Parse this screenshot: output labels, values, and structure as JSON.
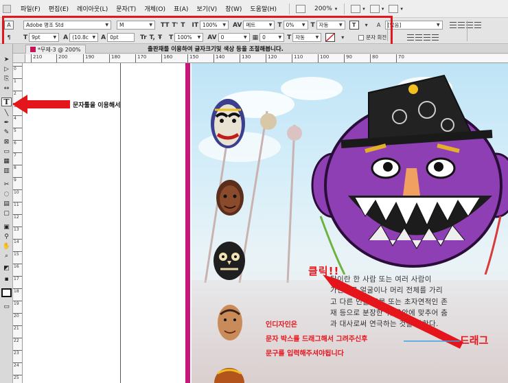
{
  "menu": {
    "items": [
      "파일(F)",
      "편집(E)",
      "레이아웃(L)",
      "문자(T)",
      "개체(O)",
      "표(A)",
      "보기(V)",
      "창(W)",
      "도움말(H)"
    ],
    "zoom": "200%"
  },
  "control_panel": {
    "font_family": "Adobe 명조 Std",
    "font_style": "M",
    "font_size": "9pt",
    "leading": "(10.8c",
    "tracking_field": "0pt",
    "vscale": "100%",
    "hscale": "100%",
    "kerning": "메트",
    "tracking": "0",
    "baseline": "0%",
    "skew": "0",
    "auto1": "자동",
    "auto2": "자동",
    "char_style": "[없음]",
    "rotate_label": "문자 회전"
  },
  "document": {
    "tab_title": "*무제-3 @ 200%",
    "banner": "출판재를 이용하여 글자크기및 색상 등을 조절해봅니다."
  },
  "ruler": {
    "h_ticks": [
      "210",
      "200",
      "190",
      "180",
      "170",
      "160",
      "150",
      "140",
      "130",
      "120",
      "110",
      "100",
      "90",
      "80",
      "70"
    ],
    "v_ticks": [
      "0",
      "1",
      "2",
      "3",
      "4",
      "5",
      "6",
      "7",
      "8",
      "9",
      "10",
      "11",
      "12",
      "13",
      "14",
      "15",
      "16",
      "17",
      "18",
      "19",
      "20",
      "21",
      "22",
      "23",
      "24",
      "25"
    ]
  },
  "body_text": {
    "lines": [
      "탈이란 한 사람 또는 여러 사람이",
      "가면으로 얼굴이나 머리 전체를 가리",
      "고 다른 인물·동물 또는 초자연적인 존",
      "재 등으로 분장한 뒤 음악에 맞추어 춤",
      "과 대사로써 연극하는 것을 말한다."
    ]
  },
  "annotations": {
    "tool_hint": "문자툴을 이용해서",
    "click": "클릭!!",
    "drag": "드래그",
    "instruction_lines": [
      "인디자인은",
      "문자 박스를 드래그해서 그려주신후",
      "문구를 입력해주셔야됩니다"
    ]
  },
  "colors": {
    "highlight": "#e4161b",
    "spine": "#c8177c",
    "mask_purple": "#8e3fb3"
  }
}
